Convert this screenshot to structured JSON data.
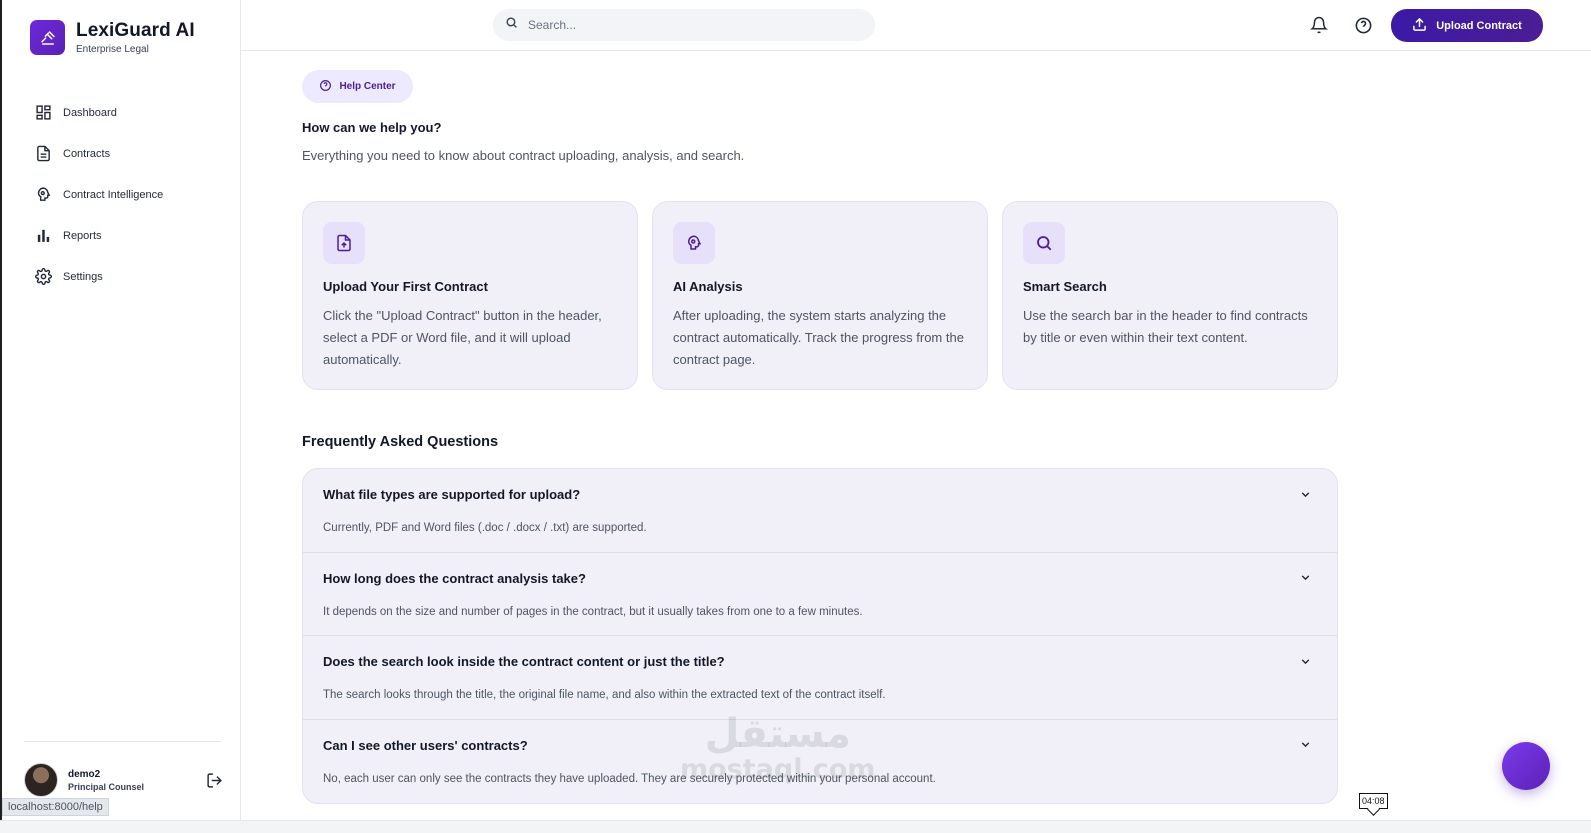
{
  "brand": {
    "name": "LexiGuard AI",
    "subtitle": "Enterprise Legal"
  },
  "sidebar": {
    "items": [
      {
        "label": "Dashboard",
        "icon": "grid-icon"
      },
      {
        "label": "Contracts",
        "icon": "document-icon"
      },
      {
        "label": "Contract Intelligence",
        "icon": "brain-icon"
      },
      {
        "label": "Reports",
        "icon": "bar-chart-icon"
      },
      {
        "label": "Settings",
        "icon": "gear-icon"
      }
    ],
    "user": {
      "name": "demo2",
      "role": "Principal Counsel"
    },
    "status_url": "localhost:8000/help"
  },
  "header": {
    "search_placeholder": "Search...",
    "upload_label": "Upload Contract"
  },
  "main": {
    "pill_label": "Help Center",
    "title": "How can we help you?",
    "subtitle": "Everything you need to know about contract uploading, analysis, and search.",
    "cards": [
      {
        "icon": "file-upload-icon",
        "title": "Upload Your First Contract",
        "desc": "Click the \"Upload Contract\" button in the header, select a PDF or Word file, and it will upload automatically."
      },
      {
        "icon": "brain-icon",
        "title": "AI Analysis",
        "desc": "After uploading, the system starts analyzing the contract automatically. Track the progress from the contract page."
      },
      {
        "icon": "search-icon",
        "title": "Smart Search",
        "desc": "Use the search bar in the header to find contracts by title or even within their text content."
      }
    ],
    "faq_title": "Frequently Asked Questions",
    "faq": [
      {
        "q": "What file types are supported for upload?",
        "a": "Currently, PDF and Word files (.doc / .docx / .txt) are supported."
      },
      {
        "q": "How long does the contract analysis take?",
        "a": "It depends on the size and number of pages in the contract, but it usually takes from one to a few minutes."
      },
      {
        "q": "Does the search look inside the contract content or just the title?",
        "a": "The search looks through the title, the original file name, and also within the extracted text of the contract itself."
      },
      {
        "q": "Can I see other users' contracts?",
        "a": "No, each user can only see the contracts they have uploaded. They are securely protected within your personal account."
      }
    ]
  },
  "overlay": {
    "time": "04:08",
    "watermark_ar": "مستقل",
    "watermark_en": "mostaql.com"
  },
  "colors": {
    "accent": "#4c1d95",
    "accent_light": "#ede9fe",
    "card_bg": "#f1f0f8"
  }
}
